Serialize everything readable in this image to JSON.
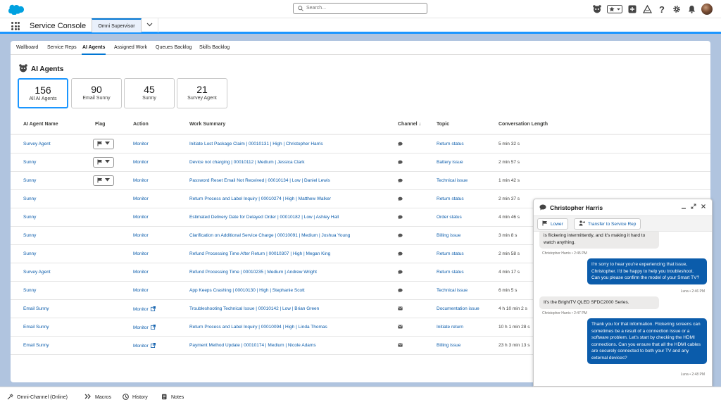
{
  "header": {
    "search_placeholder": "Search..."
  },
  "appbar": {
    "app_name": "Service Console",
    "active_tab": "Omni Supervisor"
  },
  "subtabs": [
    "Wallboard",
    "Service Reps",
    "AI Agents",
    "Assigned Work",
    "Queues Backlog",
    "Skills Backlog"
  ],
  "page": {
    "title": "AI Agents"
  },
  "stats": [
    {
      "count": "156",
      "label": "All AI Agents"
    },
    {
      "count": "90",
      "label": "Email Sunny"
    },
    {
      "count": "45",
      "label": "Sunny"
    },
    {
      "count": "21",
      "label": "Survey Agent"
    }
  ],
  "table": {
    "columns": {
      "agent": "AI Agent Name",
      "flag": "Flag",
      "action": "Action",
      "summary": "Work Summary",
      "channel": "Channel",
      "topic": "Topic",
      "length": "Conversation Length"
    },
    "rows": [
      {
        "agent": "Survey Agent",
        "action": "Monitor",
        "summary": "Initiate Lost Package Claim | 00010131 | High | Christopher Harris",
        "topic": "Return status",
        "length": "5 min 32 s"
      },
      {
        "agent": "Sunny",
        "action": "Monitor",
        "summary": "Device not charging | 00010112 | Medium | Jessica Clark",
        "topic": "Battery issue",
        "length": "2 min 57 s"
      },
      {
        "agent": "Sunny",
        "action": "Monitor",
        "summary": "Password Reset Email Not Received | 00010134 | Low | Daniel Lewis",
        "topic": "Technical issue",
        "length": "1 min 42 s"
      },
      {
        "agent": "Sunny",
        "action": "Monitor",
        "summary": "Return Process and Label Inquiry | 00010274 | High | Matthew Walker",
        "topic": "Return status",
        "length": "2 min 37 s"
      },
      {
        "agent": "Sunny",
        "action": "Monitor",
        "summary": "Estimated Delivery Date for Delayed Order | 00010182 | Low | Ashley Hall",
        "topic": "Order status",
        "length": "4 min 46 s"
      },
      {
        "agent": "Sunny",
        "action": "Monitor",
        "summary": "Clarification on Additional Service Charge | 00010091 | Medium | Joshua Young",
        "topic": "Billing issue",
        "length": "3 min 8 s"
      },
      {
        "agent": "Sunny",
        "action": "Monitor",
        "summary": "Refund Processing Time After Return | 00010307 | High | Megan King",
        "topic": "Return status",
        "length": "2 min 58 s"
      },
      {
        "agent": "Survey Agent",
        "action": "Monitor",
        "summary": "Refund Processing Time | 00010235 | Medium | Andrew Wright",
        "topic": "Return status",
        "length": "4 min 17 s"
      },
      {
        "agent": "Sunny",
        "action": "Monitor",
        "summary": "App Keeps Crashing | 00010130 | High | Stephanie Scott",
        "topic": "Technical issue",
        "length": "6 min 5 s"
      },
      {
        "agent": "Email Sunny",
        "action": "Monitor",
        "summary": "Troubleshooting Technical Issue | 00010142 | Low | Brian Green",
        "topic": "Documentation issue",
        "length": "4 h 10 min 2 s"
      },
      {
        "agent": "Email Sunny",
        "action": "Monitor",
        "summary": "Return Process and Label Inquiry | 00010094 | High | Linda Thomas",
        "topic": "Initiate return",
        "length": "10 h 1 min 28 s"
      },
      {
        "agent": "Email Sunny",
        "action": "Monitor",
        "summary": "Payment Method Update | 00010174 | Medium | Nicole Adams",
        "topic": "Billing issue",
        "length": "23 h 3 min 13 s"
      }
    ]
  },
  "chat": {
    "name": "Christopher Harris",
    "lower_label": "Lower",
    "transfer_label": "Transfer to Service Rep",
    "messages": [
      {
        "text": "is flickering intermittently, and it's making it hard to watch anything.",
        "meta": "Christopher Harris • 2:45 PM"
      },
      {
        "text": "I'm sorry to hear you're experiencing that issue, Christopher. I'd be happy to help you troubleshoot. Can you please confirm the model of your Smart TV?",
        "meta": "Luna • 2:46 PM"
      },
      {
        "text": "It's the BrightTV QLED SFDC2000 Series.",
        "meta": "Christopher Harris • 2:47 PM"
      },
      {
        "text": "Thank you for that information. Flickering screens can sometimes be a result of a connection issue or a software problem. Let's start by checking the HDMI connections. Can you ensure that all the HDMI cables are securely connected to both your TV and any external devices?",
        "meta": "Luna • 2:48 PM"
      }
    ]
  },
  "utility": {
    "omni": "Omni-Channel (Online)",
    "macros": "Macros",
    "history": "History",
    "notes": "Notes"
  },
  "colors": {
    "brand": "#0176d3",
    "link": "#0b5cab",
    "background": "#b0c4df"
  }
}
